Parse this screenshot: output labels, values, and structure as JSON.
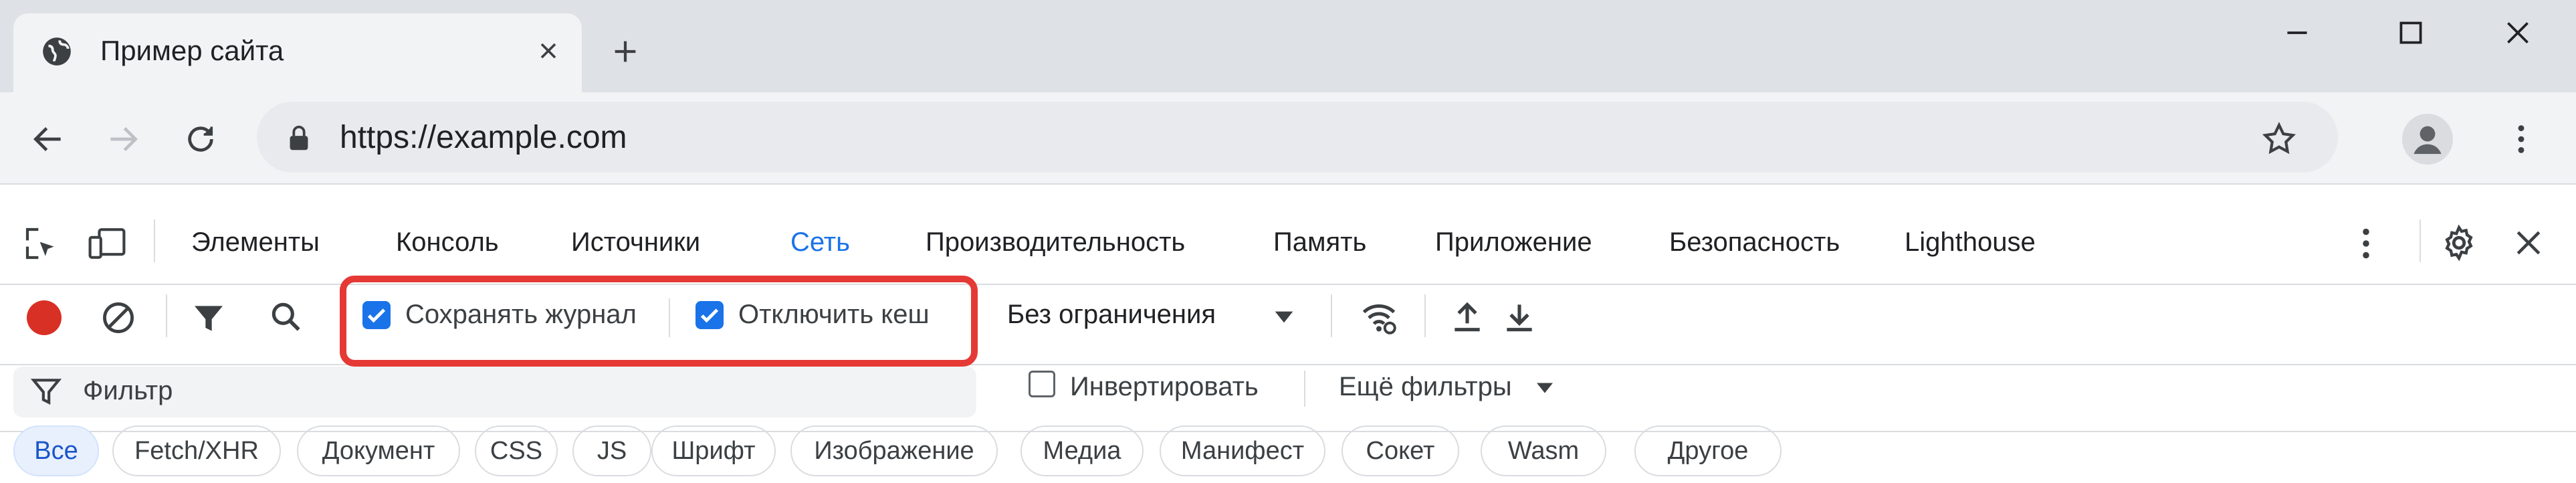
{
  "browser": {
    "tab_title": "Пример сайта",
    "url": "https://example.com"
  },
  "devtools": {
    "tabs": [
      {
        "label": "Элементы"
      },
      {
        "label": "Консоль"
      },
      {
        "label": "Источники"
      },
      {
        "label": "Сеть",
        "active": true
      },
      {
        "label": "Производительность"
      },
      {
        "label": "Память"
      },
      {
        "label": "Приложение"
      },
      {
        "label": "Безопасность"
      },
      {
        "label": "Lighthouse"
      }
    ],
    "network": {
      "preserve_log_label": "Сохранять журнал",
      "preserve_log_checked": true,
      "disable_cache_label": "Отключить кеш",
      "disable_cache_checked": true,
      "throttling_value": "Без ограничения",
      "filter_placeholder": "Фильтр",
      "invert_label": "Инвертировать",
      "invert_checked": false,
      "more_filters_label": "Ещё фильтры",
      "type_filters": [
        {
          "label": "Все",
          "active": true
        },
        {
          "label": "Fetch/XHR"
        },
        {
          "label": "Документ"
        },
        {
          "label": "CSS"
        },
        {
          "label": "JS"
        },
        {
          "label": "Шрифт"
        },
        {
          "label": "Изображение"
        },
        {
          "label": "Медиа"
        },
        {
          "label": "Манифест"
        },
        {
          "label": "Сокет"
        },
        {
          "label": "Wasm"
        },
        {
          "label": "Другое"
        }
      ]
    }
  },
  "colors": {
    "accent": "#1a73e8",
    "record": "#d93025",
    "highlight": "#e53935"
  }
}
